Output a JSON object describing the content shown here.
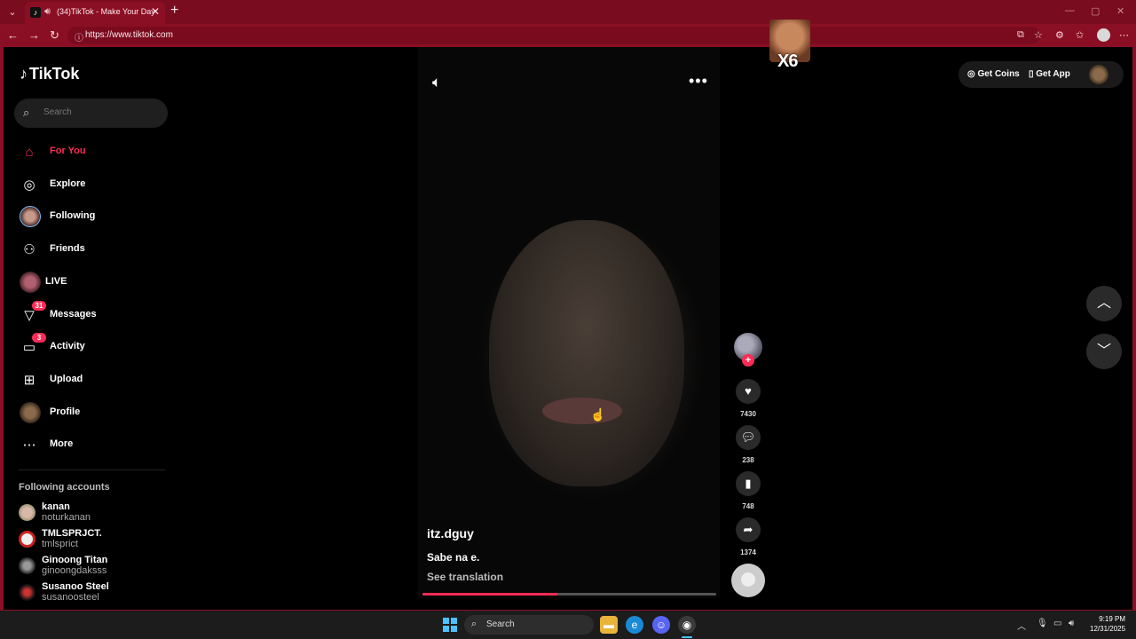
{
  "browser": {
    "tab_title": "(34)TikTok - Make Your Day",
    "tab_close": "✕",
    "new_tab": "+",
    "url": "https://www.tiktok.com",
    "sticker_text": "X6"
  },
  "tiktok": {
    "logo": "TikTok",
    "search_placeholder": "Search",
    "nav": [
      {
        "label": "For You",
        "icon": "home-icon",
        "active": true
      },
      {
        "label": "Explore",
        "icon": "compass-icon"
      },
      {
        "label": "Following",
        "icon": "avatar"
      },
      {
        "label": "Friends",
        "icon": "friends-icon"
      },
      {
        "label": "LIVE",
        "icon": "avatar"
      },
      {
        "label": "Messages",
        "icon": "send-icon",
        "badge": "31"
      },
      {
        "label": "Activity",
        "icon": "activity-icon",
        "badge": "3"
      },
      {
        "label": "Upload",
        "icon": "plus-square-icon"
      },
      {
        "label": "Profile",
        "icon": "avatar"
      },
      {
        "label": "More",
        "icon": "more-dots-icon"
      }
    ],
    "following_title": "Following accounts",
    "following_accounts": [
      {
        "name": "kanan",
        "handle": "noturkanan"
      },
      {
        "name": "TMLSPRJCT.",
        "handle": "tmlsprict"
      },
      {
        "name": "Ginoong Titan",
        "handle": "ginoongdaksss"
      },
      {
        "name": "Susanoo Steel",
        "handle": "susanoosteel"
      }
    ],
    "get_coins": "Get Coins",
    "get_app": "Get App",
    "video": {
      "author": "itz.dguy",
      "caption": "Sabe na e.",
      "see_translation": "See translation",
      "progress_percent": 46,
      "likes": "7430",
      "comments": "238",
      "saves": "748",
      "shares": "1374"
    }
  },
  "taskbar": {
    "search": "Search",
    "time": "9:19 PM",
    "date": "12/31/2025"
  },
  "colors": {
    "accent": "#fe2c55",
    "browser_frame": "#8b0f24"
  }
}
